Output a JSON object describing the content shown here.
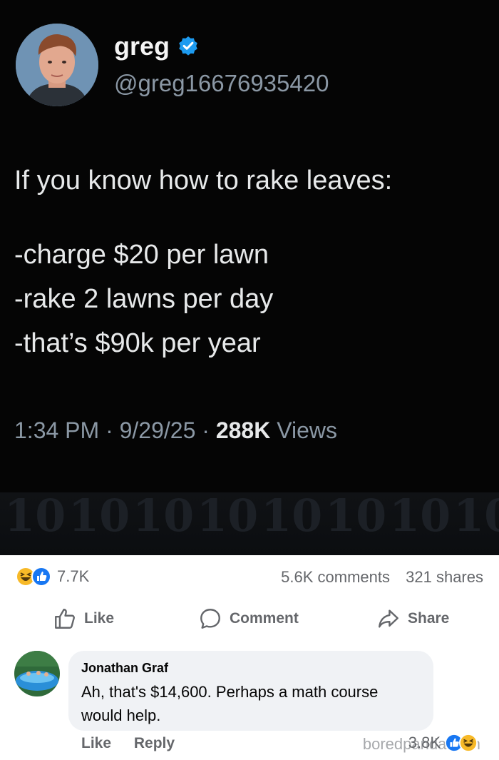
{
  "tweet": {
    "display_name": "greg",
    "handle": "@greg16676935420",
    "lines": [
      "If you know how to rake leaves:",
      "-charge $20 per lawn",
      "-rake 2 lawns per day",
      "-that’s $90k per year"
    ],
    "time": "1:34 PM",
    "date": "9/29/25",
    "views_count": "288K",
    "views_label": "Views",
    "separator": "·"
  },
  "post": {
    "reaction_count": "7.7K",
    "comments": "5.6K comments",
    "shares": "321 shares",
    "actions": {
      "like": "Like",
      "comment": "Comment",
      "share": "Share"
    }
  },
  "comment": {
    "author": "Jonathan Graf",
    "text": "Ah, that's $14,600. Perhaps a math course would help.",
    "like": "Like",
    "reply": "Reply",
    "reaction_count": "3.8K"
  },
  "watermark": "boredpanda.com",
  "colors": {
    "tweet_bg": "#050505",
    "verified_blue": "#1d9bf0",
    "facebook_blue": "#1877f2",
    "haha_yellow": "#f7b928",
    "muted_text": "#65676b",
    "bubble_bg": "#f0f2f5"
  },
  "icons": [
    "verified-badge-icon",
    "haha-reaction-icon",
    "like-reaction-icon",
    "thumbs-up-icon",
    "comment-bubble-icon",
    "share-arrow-icon"
  ]
}
